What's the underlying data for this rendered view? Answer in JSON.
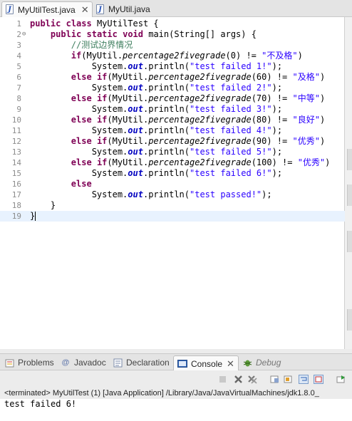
{
  "editor_tabs": [
    {
      "label": "MyUtilTest.java",
      "active": true,
      "close": "✕"
    },
    {
      "label": "MyUtil.java",
      "active": false
    }
  ],
  "code_lines": [
    {
      "n": "1",
      "parts": [
        [
          "kw",
          "public"
        ],
        [
          "t",
          " "
        ],
        [
          "kw",
          "class"
        ],
        [
          "t",
          " MyUtilTest {"
        ]
      ]
    },
    {
      "n": "2",
      "fold": "⊖",
      "parts": [
        [
          "t",
          "    "
        ],
        [
          "kw",
          "public"
        ],
        [
          "t",
          " "
        ],
        [
          "kw",
          "static"
        ],
        [
          "t",
          " "
        ],
        [
          "kw",
          "void"
        ],
        [
          "t",
          " main(String[] args) {"
        ]
      ]
    },
    {
      "n": "3",
      "parts": [
        [
          "t",
          "        "
        ],
        [
          "cmt",
          "//测试边界情况"
        ]
      ]
    },
    {
      "n": "4",
      "parts": [
        [
          "t",
          "        "
        ],
        [
          "kw",
          "if"
        ],
        [
          "t",
          "(MyUtil."
        ],
        [
          "it",
          "percentage2fivegrade"
        ],
        [
          "t",
          "(0) != "
        ],
        [
          "str",
          "\"不及格\""
        ],
        [
          "t",
          ")"
        ]
      ]
    },
    {
      "n": "5",
      "parts": [
        [
          "t",
          "            System."
        ],
        [
          "fld",
          "out"
        ],
        [
          "t",
          ".println("
        ],
        [
          "str",
          "\"test failed 1!\""
        ],
        [
          "t",
          ");"
        ]
      ]
    },
    {
      "n": "6",
      "parts": [
        [
          "t",
          "        "
        ],
        [
          "kw",
          "else"
        ],
        [
          "t",
          " "
        ],
        [
          "kw",
          "if"
        ],
        [
          "t",
          "(MyUtil."
        ],
        [
          "it",
          "percentage2fivegrade"
        ],
        [
          "t",
          "(60) != "
        ],
        [
          "str",
          "\"及格\""
        ],
        [
          "t",
          ")"
        ]
      ]
    },
    {
      "n": "7",
      "parts": [
        [
          "t",
          "            System."
        ],
        [
          "fld",
          "out"
        ],
        [
          "t",
          ".println("
        ],
        [
          "str",
          "\"test failed 2!\""
        ],
        [
          "t",
          ");"
        ]
      ]
    },
    {
      "n": "8",
      "parts": [
        [
          "t",
          "        "
        ],
        [
          "kw",
          "else"
        ],
        [
          "t",
          " "
        ],
        [
          "kw",
          "if"
        ],
        [
          "t",
          "(MyUtil."
        ],
        [
          "it",
          "percentage2fivegrade"
        ],
        [
          "t",
          "(70) != "
        ],
        [
          "str",
          "\"中等\""
        ],
        [
          "t",
          ")"
        ]
      ]
    },
    {
      "n": "9",
      "parts": [
        [
          "t",
          "            System."
        ],
        [
          "fld",
          "out"
        ],
        [
          "t",
          ".println("
        ],
        [
          "str",
          "\"test failed 3!\""
        ],
        [
          "t",
          ");"
        ]
      ]
    },
    {
      "n": "10",
      "parts": [
        [
          "t",
          "        "
        ],
        [
          "kw",
          "else"
        ],
        [
          "t",
          " "
        ],
        [
          "kw",
          "if"
        ],
        [
          "t",
          "(MyUtil."
        ],
        [
          "it",
          "percentage2fivegrade"
        ],
        [
          "t",
          "(80) != "
        ],
        [
          "str",
          "\"良好\""
        ],
        [
          "t",
          ")"
        ]
      ]
    },
    {
      "n": "11",
      "parts": [
        [
          "t",
          "            System."
        ],
        [
          "fld",
          "out"
        ],
        [
          "t",
          ".println("
        ],
        [
          "str",
          "\"test failed 4!\""
        ],
        [
          "t",
          ");"
        ]
      ]
    },
    {
      "n": "12",
      "parts": [
        [
          "t",
          "        "
        ],
        [
          "kw",
          "else"
        ],
        [
          "t",
          " "
        ],
        [
          "kw",
          "if"
        ],
        [
          "t",
          "(MyUtil."
        ],
        [
          "it",
          "percentage2fivegrade"
        ],
        [
          "t",
          "(90) != "
        ],
        [
          "str",
          "\"优秀\""
        ],
        [
          "t",
          ")"
        ]
      ]
    },
    {
      "n": "13",
      "parts": [
        [
          "t",
          "            System."
        ],
        [
          "fld",
          "out"
        ],
        [
          "t",
          ".println("
        ],
        [
          "str",
          "\"test failed 5!\""
        ],
        [
          "t",
          ");"
        ]
      ]
    },
    {
      "n": "14",
      "parts": [
        [
          "t",
          "        "
        ],
        [
          "kw",
          "else"
        ],
        [
          "t",
          " "
        ],
        [
          "kw",
          "if"
        ],
        [
          "t",
          "(MyUtil."
        ],
        [
          "it",
          "percentage2fivegrade"
        ],
        [
          "t",
          "(100) != "
        ],
        [
          "str",
          "\"优秀\""
        ],
        [
          "t",
          ")"
        ]
      ]
    },
    {
      "n": "15",
      "parts": [
        [
          "t",
          "            System."
        ],
        [
          "fld",
          "out"
        ],
        [
          "t",
          ".println("
        ],
        [
          "str",
          "\"test failed 6!\""
        ],
        [
          "t",
          ");"
        ]
      ]
    },
    {
      "n": "16",
      "parts": [
        [
          "t",
          "        "
        ],
        [
          "kw",
          "else"
        ]
      ]
    },
    {
      "n": "17",
      "parts": [
        [
          "t",
          "            System."
        ],
        [
          "fld",
          "out"
        ],
        [
          "t",
          ".println("
        ],
        [
          "str",
          "\"test passed!\""
        ],
        [
          "t",
          ");"
        ]
      ]
    },
    {
      "n": "18",
      "parts": [
        [
          "t",
          "    }"
        ]
      ]
    },
    {
      "n": "19",
      "current": true,
      "parts": [
        [
          "t",
          "}"
        ]
      ]
    }
  ],
  "view_tabs": [
    {
      "label": "Problems",
      "icon": "problems-icon"
    },
    {
      "label": "Javadoc",
      "icon": "javadoc-icon"
    },
    {
      "label": "Declaration",
      "icon": "declaration-icon"
    },
    {
      "label": "Console",
      "icon": "console-icon",
      "active": true,
      "close": "✕"
    },
    {
      "label": "Debug",
      "icon": "debug-icon",
      "dim": true
    }
  ],
  "console": {
    "info": "<terminated> MyUtilTest (1) [Java Application] /Library/Java/JavaVirtualMachines/jdk1.8.0_",
    "output": "test failed 6!"
  },
  "colors": {
    "keyword": "#7f0055",
    "string": "#2a00ff",
    "comment": "#3f7f5f",
    "field": "#0000c0",
    "current_line": "#e8f2fe"
  }
}
